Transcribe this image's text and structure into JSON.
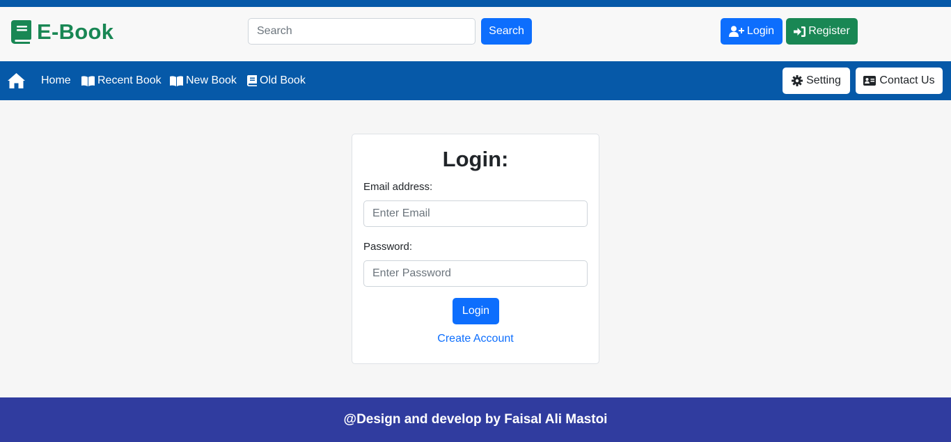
{
  "header": {
    "brand": "E-Book",
    "search_placeholder": "Search",
    "search_button": "Search",
    "login_button": "Login",
    "register_button": "Register"
  },
  "nav": {
    "items": [
      {
        "label": "Home"
      },
      {
        "label": "Recent Book"
      },
      {
        "label": "New Book"
      },
      {
        "label": "Old Book"
      }
    ],
    "setting_button": "Setting",
    "contact_button": "Contact Us"
  },
  "login_card": {
    "title": "Login:",
    "email_label": "Email address:",
    "email_placeholder": "Enter Email",
    "password_label": "Password:",
    "password_placeholder": "Enter Password",
    "submit_button": "Login",
    "create_account_link": "Create Account"
  },
  "footer": {
    "text": "@Design and develop by Faisal Ali Mastoi"
  },
  "colors": {
    "brand_green": "#198754",
    "primary_blue": "#0d6efd",
    "nav_blue": "#0659a8",
    "footer_indigo": "#303c9f"
  }
}
